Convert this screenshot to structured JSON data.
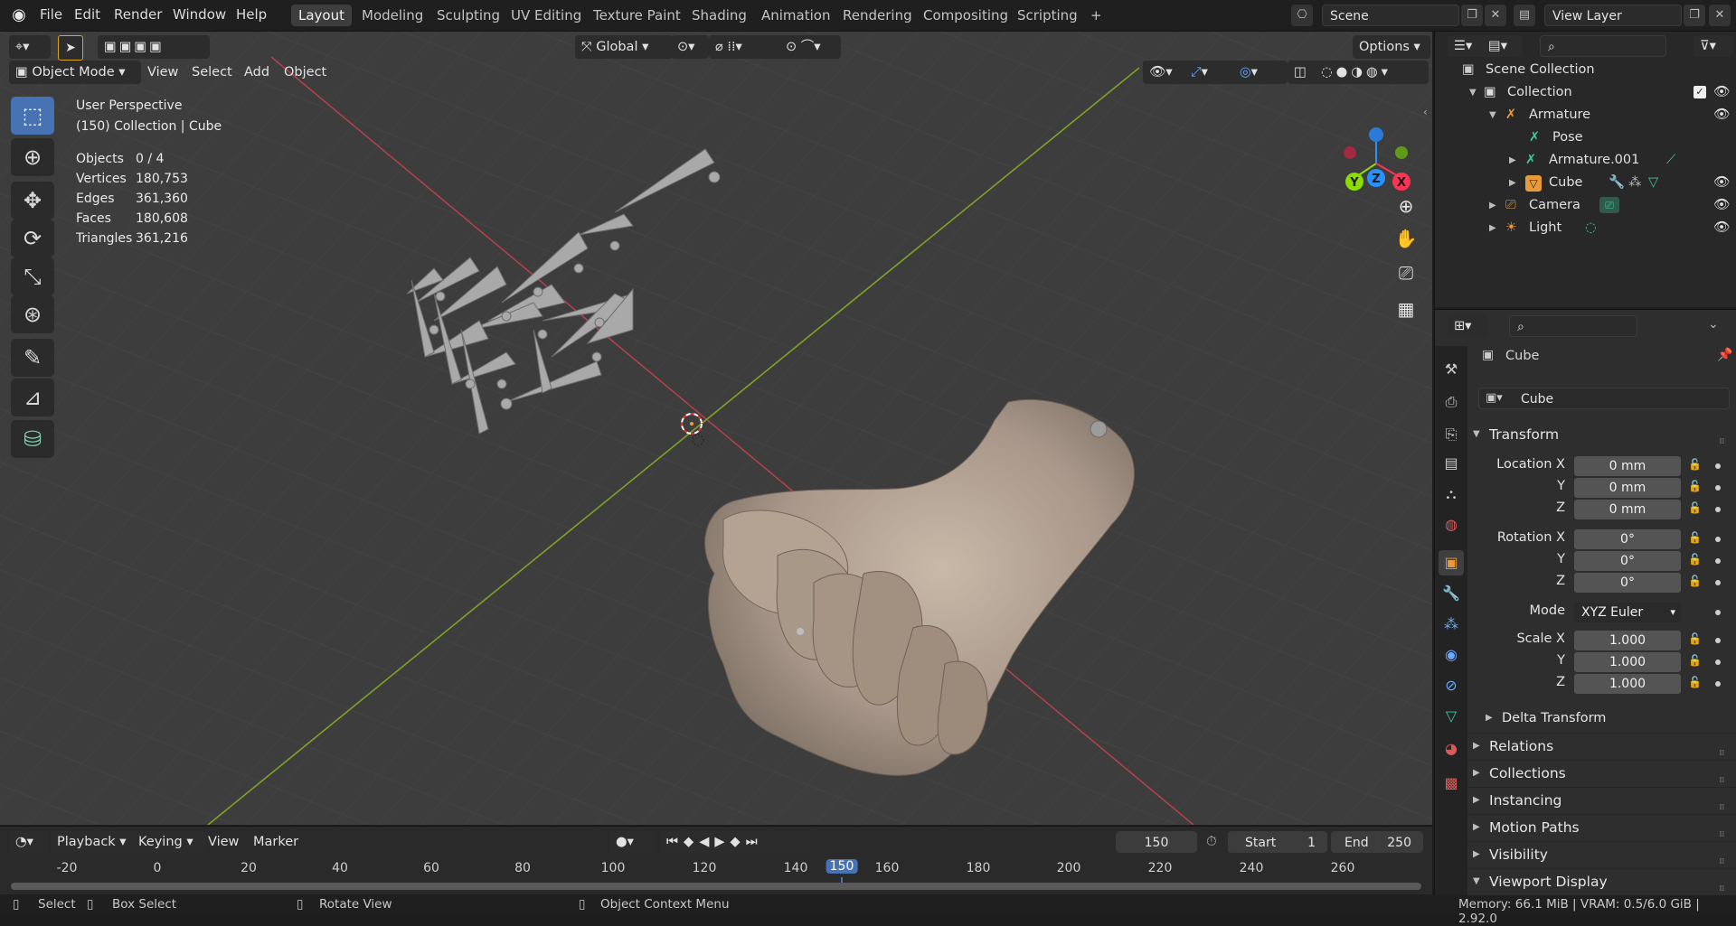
{
  "topbar": {
    "menus": [
      "File",
      "Edit",
      "Render",
      "Window",
      "Help"
    ],
    "workspaces": [
      "Layout",
      "Modeling",
      "Sculpting",
      "UV Editing",
      "Texture Paint",
      "Shading",
      "Animation",
      "Rendering",
      "Compositing",
      "Scripting"
    ],
    "active_workspace": "Layout",
    "add_tab": "+",
    "scene": "Scene",
    "view_layer": "View Layer"
  },
  "viewport": {
    "transform_orientation": "Global",
    "options_label": "Options",
    "mode": "Object Mode",
    "menus": [
      "View",
      "Select",
      "Add",
      "Object"
    ],
    "overlay_text": {
      "view_name": "User Perspective",
      "collection_info": "(150) Collection | Cube"
    },
    "stats": [
      {
        "label": "Objects",
        "value": "0 / 4"
      },
      {
        "label": "Vertices",
        "value": "180,753"
      },
      {
        "label": "Edges",
        "value": "361,360"
      },
      {
        "label": "Faces",
        "value": "180,608"
      },
      {
        "label": "Triangles",
        "value": "361,216"
      }
    ],
    "gizmo_axes": {
      "x": "X",
      "y": "Y",
      "z": "Z"
    },
    "axis_colors": {
      "x": "#ff3352",
      "y": "#8bdc00",
      "z": "#2890ff"
    }
  },
  "timeline": {
    "menus": [
      "Playback",
      "Keying",
      "View",
      "Marker"
    ],
    "current_frame": "150",
    "start_label": "Start",
    "start": "1",
    "end_label": "End",
    "end": "250",
    "ticks": [
      "-20",
      "0",
      "20",
      "40",
      "60",
      "80",
      "100",
      "120",
      "140",
      "150",
      "160",
      "180",
      "200",
      "220",
      "240",
      "260"
    ]
  },
  "statusbar": {
    "select": "Select",
    "box_select": "Box Select",
    "rotate_view": "Rotate View",
    "context_menu": "Object Context Menu",
    "memory": "Memory: 66.1 MiB | VRAM: 0.5/6.0 GiB | 2.92.0"
  },
  "outliner": {
    "root": "Scene Collection",
    "items": [
      {
        "label": "Collection"
      },
      {
        "label": "Armature"
      },
      {
        "label": "Pose"
      },
      {
        "label": "Armature.001"
      },
      {
        "label": "Cube"
      },
      {
        "label": "Camera"
      },
      {
        "label": "Light"
      }
    ]
  },
  "properties": {
    "object_name": "Cube",
    "data_name": "Cube",
    "transform": {
      "title": "Transform",
      "location_label": "Location X",
      "y_label": "Y",
      "z_label": "Z",
      "location": [
        "0 mm",
        "0 mm",
        "0 mm"
      ],
      "rotation_label": "Rotation X",
      "rotation": [
        "0°",
        "0°",
        "0°"
      ],
      "mode_label": "Mode",
      "mode": "XYZ Euler",
      "scale_label": "Scale X",
      "scale": [
        "1.000",
        "1.000",
        "1.000"
      ]
    },
    "delta": "Delta Transform",
    "panels": [
      "Relations",
      "Collections",
      "Instancing",
      "Motion Paths",
      "Visibility",
      "Viewport Display"
    ]
  }
}
